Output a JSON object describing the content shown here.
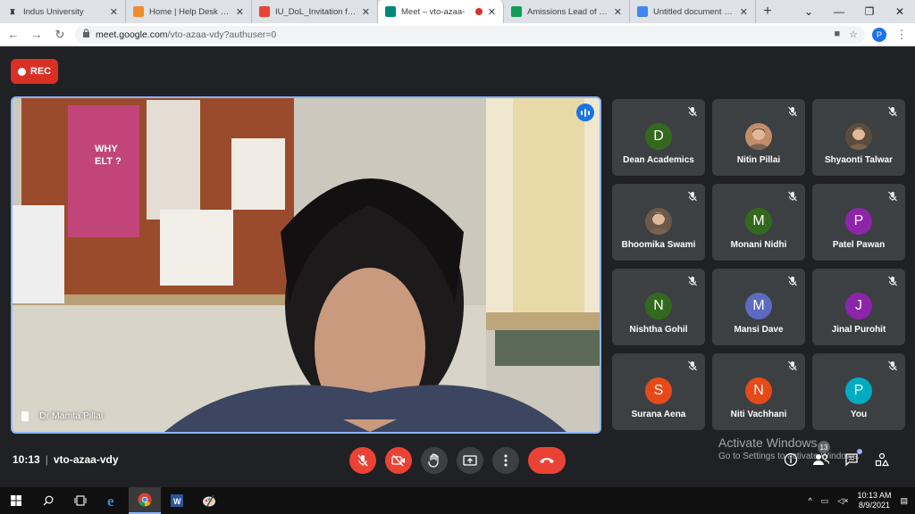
{
  "browser": {
    "tabs": [
      {
        "label": "Indus University",
        "favicon": "indus-icon",
        "color": "#ffffff",
        "active": false
      },
      {
        "label": "Home | Help Desk - Sy",
        "favicon": "helpdesk-icon",
        "color": "#f28b30",
        "active": false
      },
      {
        "label": "IU_DoL_Invitation for (",
        "favicon": "gmail-icon",
        "color": "#ea4335",
        "active": false
      },
      {
        "label": "Meet – vto-azaa-",
        "favicon": "meet-icon",
        "color": "#00897b",
        "active": true
      },
      {
        "label": "Amissions Lead of MA",
        "favicon": "sheets-icon",
        "color": "#0f9d58",
        "active": false
      },
      {
        "label": "Untitled document - G",
        "favicon": "docs-icon",
        "color": "#4285f4",
        "active": false
      }
    ],
    "url_host": "meet.google.com",
    "url_path": "/vto-azaa-vdy?authuser=0",
    "profile_initial": "P"
  },
  "meet": {
    "rec_label": "REC",
    "main_speaker": "Dr Mamta Pillai",
    "participants": [
      {
        "name": "Dean Academics",
        "initial": "D",
        "color": "#33691e",
        "photo": false
      },
      {
        "name": "Nitin Pillai",
        "initial": "",
        "color": "#c48d6a",
        "photo": true
      },
      {
        "name": "Shyaonti Talwar",
        "initial": "",
        "color": "#5d4c3d",
        "photo": true
      },
      {
        "name": "Bhoomika Swami",
        "initial": "",
        "color": "#6b5a4a",
        "photo": true
      },
      {
        "name": "Monani Nidhi",
        "initial": "M",
        "color": "#33691e",
        "photo": false
      },
      {
        "name": "Patel Pawan",
        "initial": "P",
        "color": "#8e24aa",
        "photo": false
      },
      {
        "name": "Nishtha Gohil",
        "initial": "N",
        "color": "#33691e",
        "photo": false
      },
      {
        "name": "Mansi Dave",
        "initial": "M",
        "color": "#5c6bc0",
        "photo": false
      },
      {
        "name": "Jinal Purohit",
        "initial": "J",
        "color": "#8e24aa",
        "photo": false
      },
      {
        "name": "Surana Aena",
        "initial": "S",
        "color": "#e64a19",
        "photo": false
      },
      {
        "name": "Niti Vachhani",
        "initial": "N",
        "color": "#e64a19",
        "photo": false
      },
      {
        "name": "You",
        "initial": "P",
        "color": "#00acc1",
        "photo": false
      }
    ],
    "time": "10:13",
    "meeting_code": "vto-azaa-vdy",
    "people_count": "13"
  },
  "watermark": {
    "line1": "Activate Windows",
    "line2": "Go to Settings to activate Windows."
  },
  "taskbar": {
    "time": "10:13 AM",
    "date": "8/9/2021"
  }
}
